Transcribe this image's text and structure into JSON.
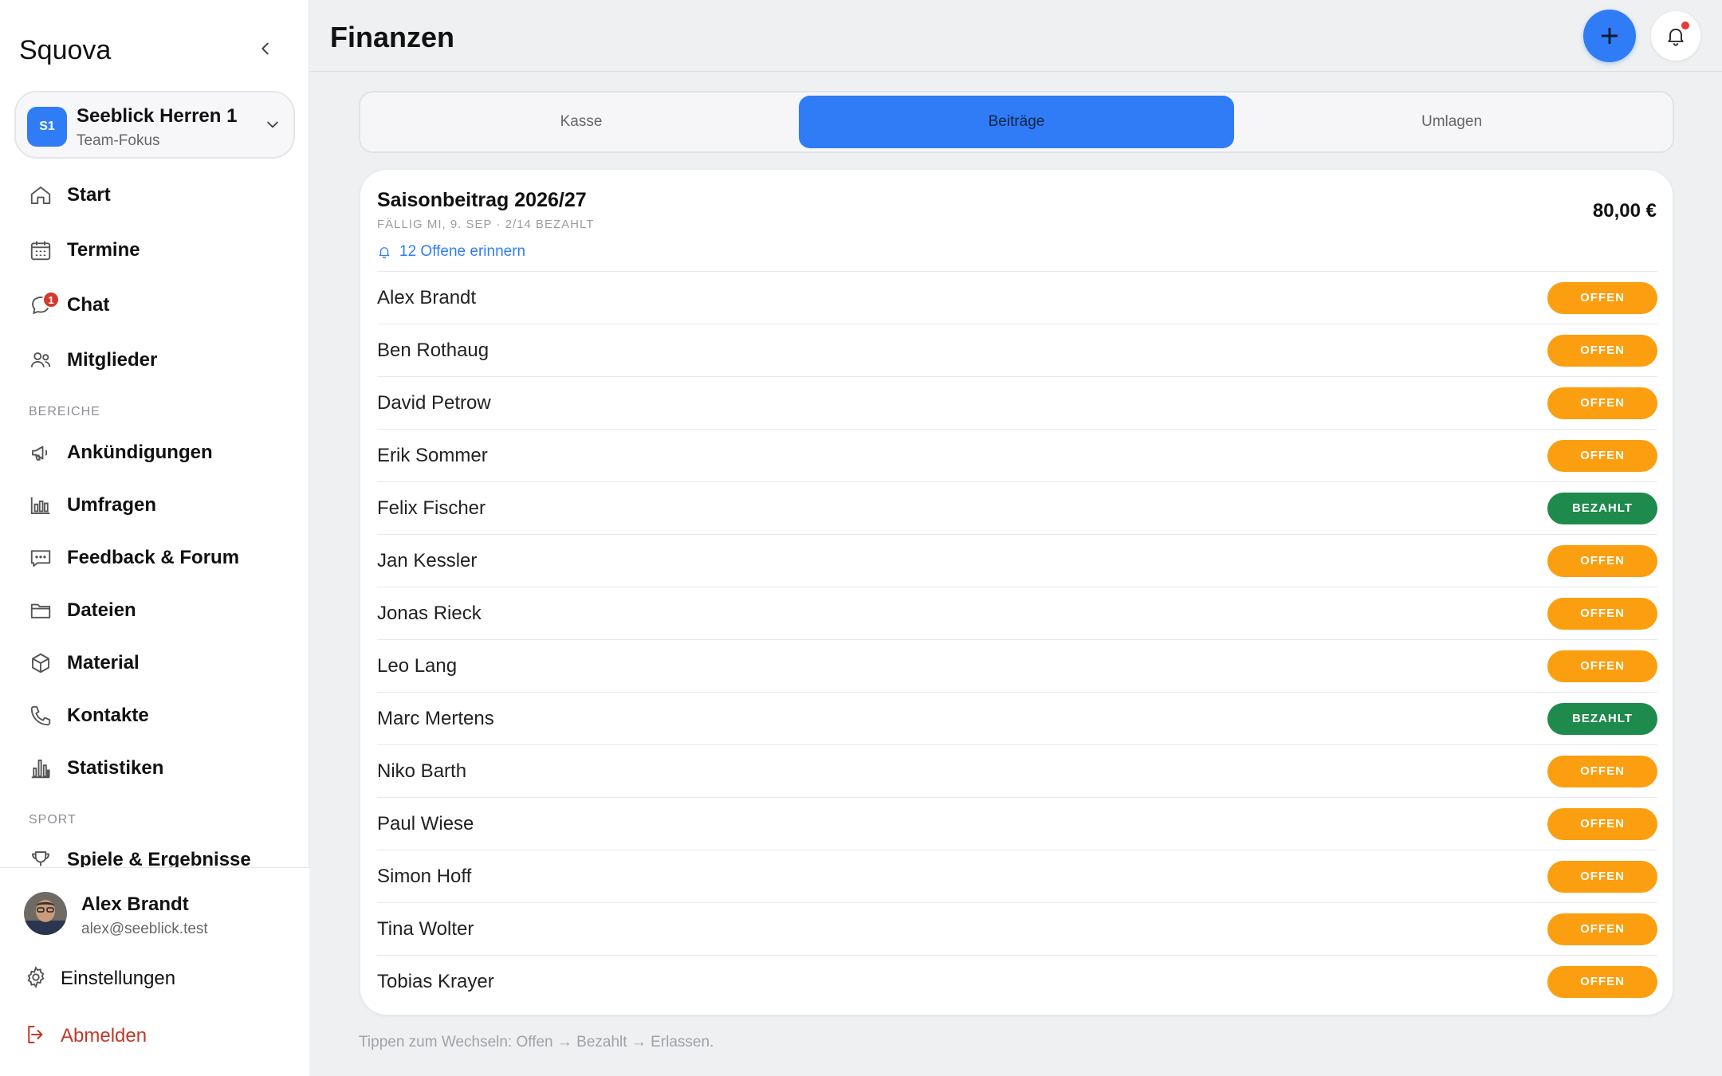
{
  "app": {
    "name": "Squova"
  },
  "team": {
    "badge": "S1",
    "name": "Seeblick Herren 1",
    "subtitle": "Team-Fokus"
  },
  "nav": {
    "start": "Start",
    "termine": "Termine",
    "chat": "Chat",
    "chat_badge": "1",
    "mitglieder": "Mitglieder",
    "section_bereiche": "BEREICHE",
    "ankuendigungen": "Ankündigungen",
    "umfragen": "Umfragen",
    "feedback": "Feedback & Forum",
    "dateien": "Dateien",
    "material": "Material",
    "kontakte": "Kontakte",
    "statistiken": "Statistiken",
    "section_sport": "SPORT",
    "spiele": "Spiele & Ergebnisse"
  },
  "user": {
    "name": "Alex Brandt",
    "email": "alex@seeblick.test"
  },
  "footer": {
    "settings": "Einstellungen",
    "logout": "Abmelden"
  },
  "header": {
    "title": "Finanzen"
  },
  "tabs": [
    {
      "label": "Kasse",
      "active": false
    },
    {
      "label": "Beiträge",
      "active": true
    },
    {
      "label": "Umlagen",
      "active": false
    }
  ],
  "fee": {
    "title": "Saisonbeitrag 2026/27",
    "meta": "FÄLLIG MI, 9. SEP · 2/14 BEZAHLT",
    "remind": "12 Offene erinnern",
    "amount": "80,00 €"
  },
  "members": [
    {
      "name": "Alex Brandt",
      "status": "OFFEN"
    },
    {
      "name": "Ben Rothaug",
      "status": "OFFEN"
    },
    {
      "name": "David Petrow",
      "status": "OFFEN"
    },
    {
      "name": "Erik Sommer",
      "status": "OFFEN"
    },
    {
      "name": "Felix Fischer",
      "status": "BEZAHLT"
    },
    {
      "name": "Jan Kessler",
      "status": "OFFEN"
    },
    {
      "name": "Jonas Rieck",
      "status": "OFFEN"
    },
    {
      "name": "Leo Lang",
      "status": "OFFEN"
    },
    {
      "name": "Marc Mertens",
      "status": "BEZAHLT"
    },
    {
      "name": "Niko Barth",
      "status": "OFFEN"
    },
    {
      "name": "Paul Wiese",
      "status": "OFFEN"
    },
    {
      "name": "Simon Hoff",
      "status": "OFFEN"
    },
    {
      "name": "Tina Wolter",
      "status": "OFFEN"
    },
    {
      "name": "Tobias Krayer",
      "status": "OFFEN"
    }
  ],
  "hint": "Tippen zum Wechseln: Offen → Bezahlt → Erlassen.",
  "colors": {
    "accent": "#2f7cf6",
    "open": "#fb9e10",
    "paid": "#1e8a4c",
    "danger": "#c0392b"
  }
}
